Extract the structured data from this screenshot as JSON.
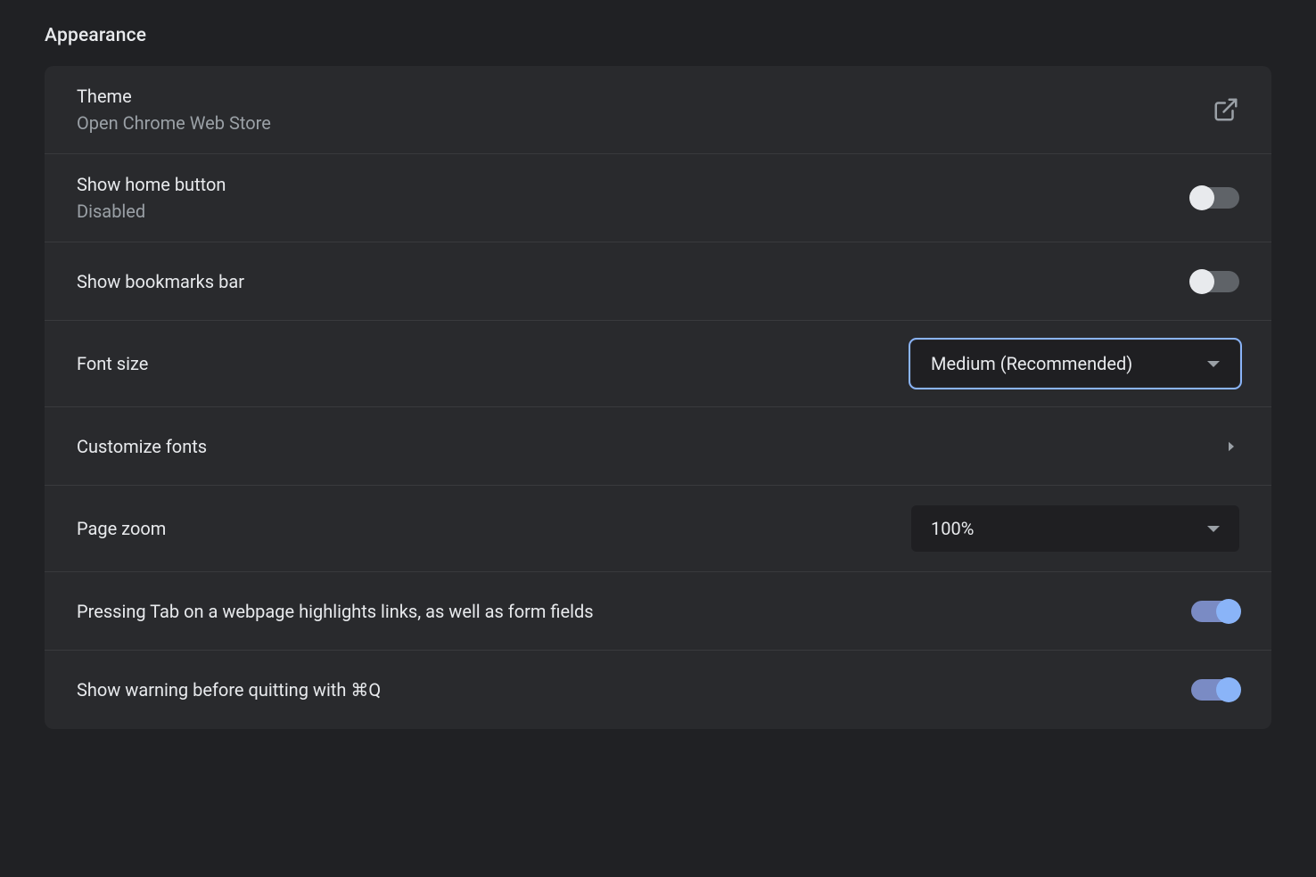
{
  "section_title": "Appearance",
  "rows": {
    "theme": {
      "label": "Theme",
      "sublabel": "Open Chrome Web Store"
    },
    "home_button": {
      "label": "Show home button",
      "sublabel": "Disabled",
      "enabled": false
    },
    "bookmarks_bar": {
      "label": "Show bookmarks bar",
      "enabled": false
    },
    "font_size": {
      "label": "Font size",
      "value": "Medium (Recommended)"
    },
    "customize_fonts": {
      "label": "Customize fonts"
    },
    "page_zoom": {
      "label": "Page zoom",
      "value": "100%"
    },
    "tab_highlight": {
      "label": "Pressing Tab on a webpage highlights links, as well as form fields",
      "enabled": true
    },
    "quit_warning": {
      "label": "Show warning before quitting with ⌘Q",
      "enabled": true
    }
  }
}
